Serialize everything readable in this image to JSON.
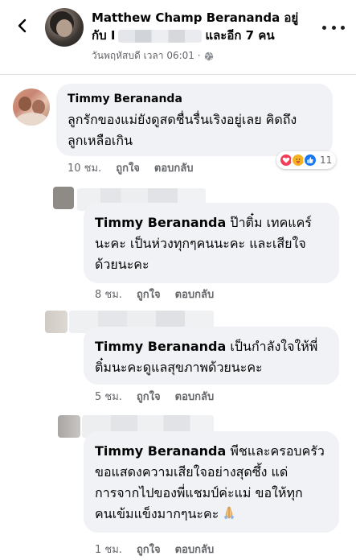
{
  "header": {
    "title_name": "Matthew Champ Berananda",
    "title_suffix": "อยู่",
    "with_prefix": "กับ",
    "with_letter": "I",
    "with_others": "และอีก 7 คน",
    "meta": "วันพฤหัสบดี เวลา 06:01 ·"
  },
  "comments": [
    {
      "name": "Timmy Berananda",
      "text_line1": "ลูกรักของแม่ยังดูสดชื่นรื่นเริงอยู่เลย คิดถึง",
      "text_line2": "ลูกเหลือเกิน",
      "time": "10 ชม.",
      "like": "ถูกใจ",
      "reply": "ตอบกลับ",
      "reaction_count": "11"
    }
  ],
  "replies": [
    {
      "name": "Timmy Berananda",
      "line1": "ป๊าติ๋ม เทคแคร์",
      "line2": "นะคะ เป็นห่วงทุกๆคนนะคะ และเสียใจ",
      "line3": "ด้วยนะคะ",
      "time": "8 ชม.",
      "like": "ถูกใจ",
      "reply": "ตอบกลับ"
    },
    {
      "name": "Timmy Berananda",
      "line1": "เป็นกำลังใจให้พี่",
      "line2": "ติ๋มนะคะดูแลสุขภาพด้วยนะคะ",
      "time": "5 ชม.",
      "like": "ถูกใจ",
      "reply": "ตอบกลับ"
    },
    {
      "name": "Timmy Berananda",
      "line1": "พีชและครอบครัว",
      "line2": "ขอแสดงความเสียใจอย่างสุดซึ้ง แด่",
      "line3": "การจากไปของพี่แชมป์ค่ะแม่ ขอให้ทุก",
      "line4": "คนเข้มแข็งมากๆนะคะ",
      "time": "1 ชม.",
      "like": "ถูกใจ",
      "reply": "ตอบกลับ"
    }
  ],
  "icons": {
    "back": "chevron-left-icon",
    "more": "more-dots-icon",
    "privacy": "globe-icon",
    "reactions": [
      "love-icon",
      "care-icon",
      "like-icon"
    ],
    "emoji": "praying-hands-icon"
  },
  "colors": {
    "bubble": "#f0f2f5",
    "secondary_text": "#65676b",
    "like_blue": "#1877f2",
    "love_red": "#f33e58",
    "care_yellow": "#f7b125"
  }
}
